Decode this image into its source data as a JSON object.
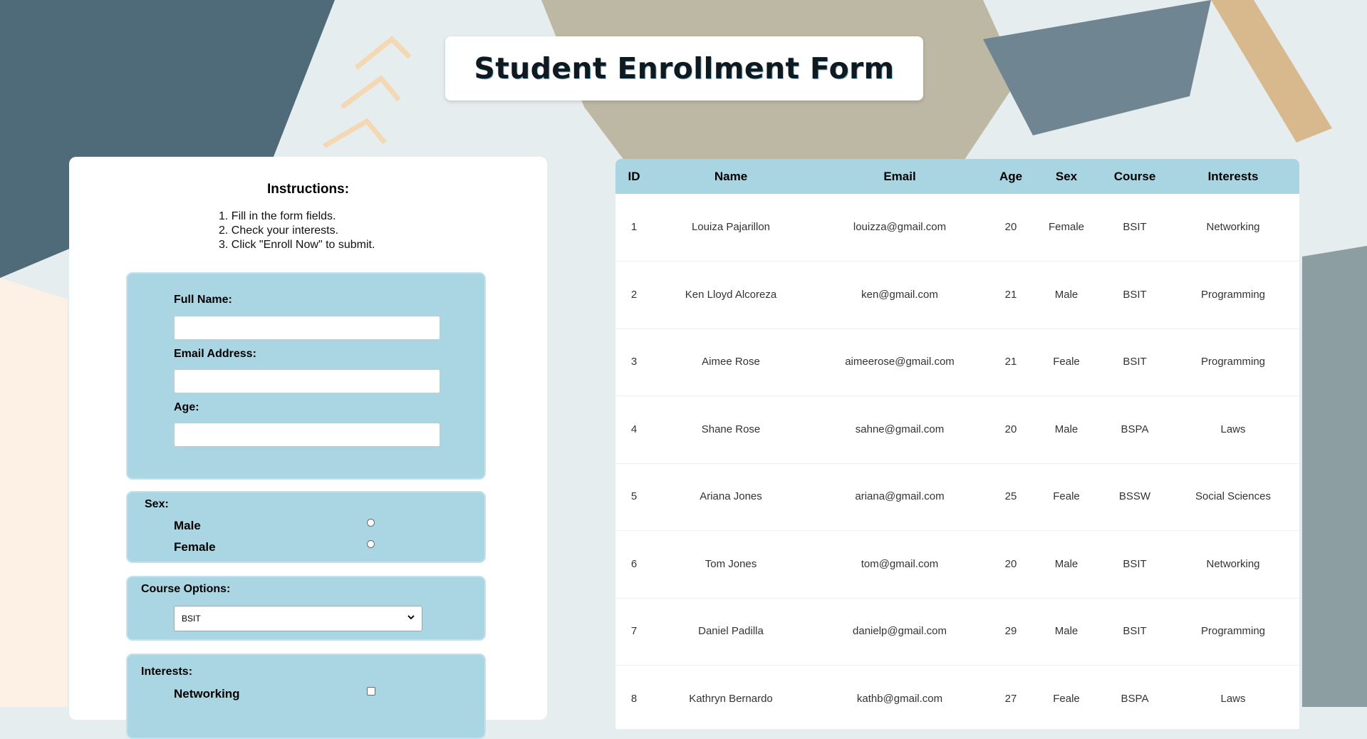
{
  "title": "Student Enrollment Form",
  "instructions": {
    "heading": "Instructions:",
    "steps": [
      "1. Fill in the form fields.",
      "2. Check your interests.",
      "3. Click \"Enroll Now\" to submit."
    ]
  },
  "form": {
    "full_name": {
      "label": "Full Name:",
      "value": ""
    },
    "email": {
      "label": "Email Address:",
      "value": ""
    },
    "age": {
      "label": "Age:",
      "value": ""
    },
    "sex": {
      "label": "Sex:",
      "options": [
        "Male",
        "Female"
      ]
    },
    "course": {
      "label": "Course Options:",
      "selected": "BSIT"
    },
    "interests": {
      "label": "Interests:",
      "options": [
        "Networking"
      ]
    }
  },
  "table": {
    "columns": [
      "ID",
      "Name",
      "Email",
      "Age",
      "Sex",
      "Course",
      "Interests"
    ],
    "rows": [
      [
        "1",
        "Louiza Pajarillon",
        "louizza@gmail.com",
        "20",
        "Female",
        "BSIT",
        "Networking"
      ],
      [
        "2",
        "Ken Lloyd Alcoreza",
        "ken@gmail.com",
        "21",
        "Male",
        "BSIT",
        "Programming"
      ],
      [
        "3",
        "Aimee Rose",
        "aimeerose@gmail.com",
        "21",
        "Feale",
        "BSIT",
        "Programming"
      ],
      [
        "4",
        "Shane Rose",
        "sahne@gmail.com",
        "20",
        "Male",
        "BSPA",
        "Laws"
      ],
      [
        "5",
        "Ariana Jones",
        "ariana@gmail.com",
        "25",
        "Feale",
        "BSSW",
        "Social Sciences"
      ],
      [
        "6",
        "Tom Jones",
        "tom@gmail.com",
        "20",
        "Male",
        "BSIT",
        "Networking"
      ],
      [
        "7",
        "Daniel Padilla",
        "danielp@gmail.com",
        "29",
        "Male",
        "BSIT",
        "Programming"
      ],
      [
        "8",
        "Kathryn Bernardo",
        "kathb@gmail.com",
        "27",
        "Feale",
        "BSPA",
        "Laws"
      ]
    ]
  },
  "colors": {
    "accent": "#aad6e4",
    "header": "#a9d5e3"
  },
  "icons": {
    "select": "chevron-down-icon"
  }
}
